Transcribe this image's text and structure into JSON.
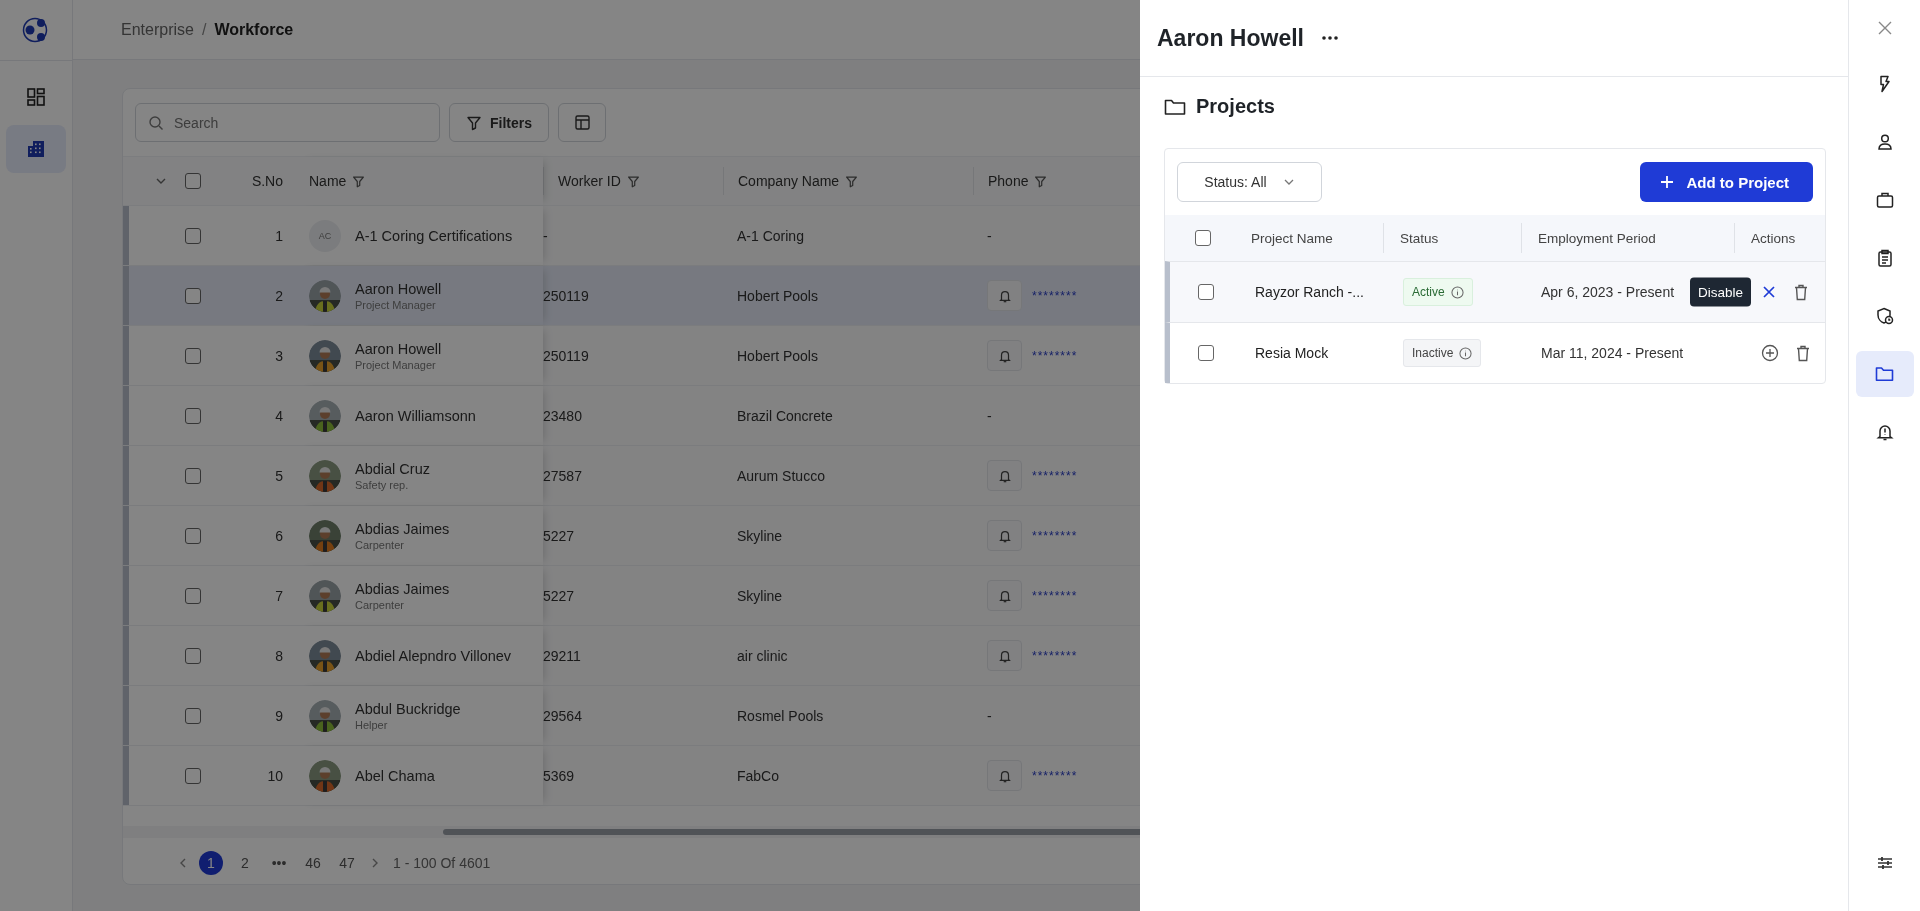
{
  "nav": {
    "items": [
      {
        "kind": "dashboard",
        "selected": false
      },
      {
        "kind": "buildings",
        "selected": true
      }
    ]
  },
  "breadcrumb": {
    "separator": "/",
    "items": [
      "Enterprise",
      "Workforce"
    ]
  },
  "toolbar": {
    "search": {
      "placeholder": "Search"
    },
    "filters_button": "Filters"
  },
  "table": {
    "header_checked": false,
    "columns": [
      "S.No",
      "Name",
      "Worker ID",
      "Company Name",
      "Phone"
    ],
    "rows": [
      {
        "sno": "1",
        "avatar": {
          "kind": "initials",
          "text": "AC"
        },
        "name": "A-1 Coring Certifications",
        "worker_id": "-",
        "company": "A-1 Coring",
        "phone": "-",
        "alert_button": false,
        "checked": false,
        "selected": false
      },
      {
        "sno": "2",
        "name": "Aaron Howell",
        "role": "Project Manager",
        "worker_id": "250119",
        "company": "Hobert Pools",
        "phone": "********",
        "alert_button": true,
        "checked": false,
        "selected": true
      },
      {
        "sno": "3",
        "name": "Aaron Howell",
        "role": "Project Manager",
        "worker_id": "250119",
        "company": "Hobert Pools",
        "phone": "********",
        "alert_button": true,
        "checked": false,
        "selected": false
      },
      {
        "sno": "4",
        "name": "Aaron Williamsonn",
        "worker_id": "23480",
        "company": "Brazil Concrete",
        "phone": "-",
        "alert_button": false,
        "checked": false,
        "selected": false
      },
      {
        "sno": "5",
        "name": "Abdial Cruz",
        "role": "Safety rep.",
        "worker_id": "27587",
        "company": "Aurum Stucco",
        "phone": "********",
        "alert_button": true,
        "checked": false,
        "selected": false
      },
      {
        "sno": "6",
        "name": "Abdias Jaimes",
        "role": "Carpenter",
        "worker_id": "5227",
        "company": "Skyline",
        "phone": "********",
        "alert_button": true,
        "checked": false,
        "selected": false
      },
      {
        "sno": "7",
        "name": "Abdias Jaimes",
        "role": "Carpenter",
        "worker_id": "5227",
        "company": "Skyline",
        "phone": "********",
        "alert_button": true,
        "checked": false,
        "selected": false
      },
      {
        "sno": "8",
        "name": "Abdiel Alepndro Villonev",
        "worker_id": "29211",
        "company": "air clinic",
        "phone": "********",
        "alert_button": true,
        "checked": false,
        "selected": false
      },
      {
        "sno": "9",
        "name": "Abdul Buckridge",
        "role": "Helper",
        "worker_id": "29564",
        "company": "Rosmel Pools",
        "phone": "-",
        "alert_button": false,
        "checked": false,
        "selected": false
      },
      {
        "sno": "10",
        "name": "Abel Chama",
        "worker_id": "5369",
        "company": "FabCo",
        "phone": "********",
        "alert_button": true,
        "checked": false,
        "selected": false
      }
    ]
  },
  "pagination": {
    "pages": [
      {
        "label": "1",
        "selected": true
      },
      {
        "label": "2",
        "selected": false
      },
      {
        "label": "•••",
        "selected": false
      },
      {
        "label": "46",
        "selected": false
      },
      {
        "label": "47",
        "selected": false
      }
    ],
    "summary": "1 - 100 Of 4601"
  },
  "drawer": {
    "title": "Aaron Howell",
    "section_title": "Projects",
    "status_filter": "Status: All",
    "add_button": "Add to Project",
    "header_checked": false,
    "columns": [
      "Project Name",
      "Status",
      "Employment Period",
      "Actions"
    ],
    "rows": [
      {
        "name": "Rayzor Ranch -...",
        "status": {
          "label": "Active",
          "kind": "active"
        },
        "period": "Apr 6, 2023 - Present",
        "action": {
          "kind": "disable",
          "tooltip": "Disable"
        },
        "checked": false
      },
      {
        "name": "Resia Mock",
        "status": {
          "label": "Inactive",
          "kind": "inactive"
        },
        "period": "Mar 11, 2024 - Present",
        "action": {
          "kind": "enable"
        },
        "checked": false
      }
    ]
  },
  "rail": {
    "items": [
      {
        "kind": "bolt",
        "selected": false
      },
      {
        "kind": "person",
        "selected": false
      },
      {
        "kind": "briefcase",
        "selected": false
      },
      {
        "kind": "clipboard",
        "selected": false
      },
      {
        "kind": "shield",
        "selected": false
      },
      {
        "kind": "folder",
        "selected": true
      },
      {
        "kind": "alert-bell",
        "selected": false
      }
    ]
  }
}
